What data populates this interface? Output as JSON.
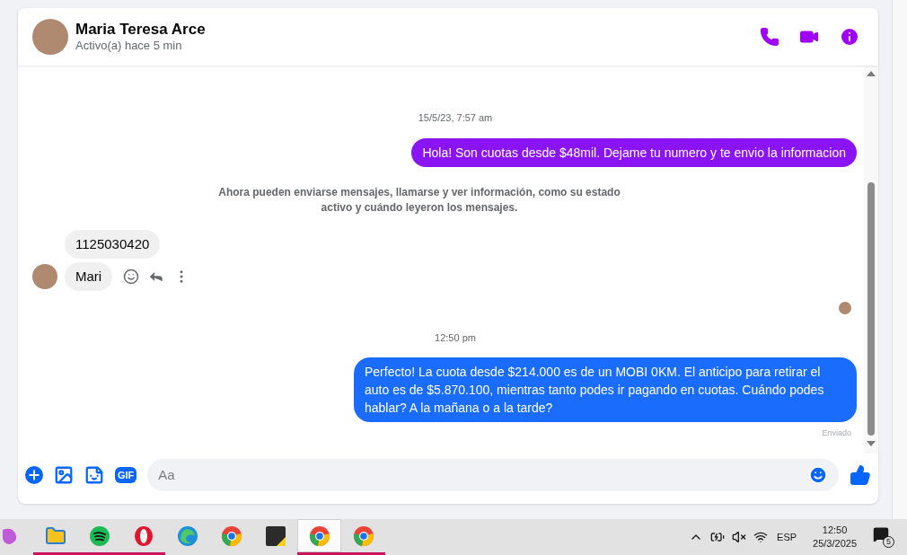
{
  "header": {
    "name": "Maria Teresa Arce",
    "status": "Activo(a) hace 5 min"
  },
  "messages": [
    {
      "kind": "timestamp",
      "text": "15/5/23, 7:57 am"
    },
    {
      "kind": "outgoing",
      "color": "#8b14f5",
      "text": "Hola! Son cuotas desde $48mil. Dejame tu numero  y te envio la informacion"
    },
    {
      "kind": "notice",
      "text": "Ahora pueden enviarse mensajes, llamarse y ver información, como su estado activo y cuándo leyeron los mensajes."
    },
    {
      "kind": "incoming",
      "texts": [
        "1125030420",
        "Mari"
      ]
    },
    {
      "kind": "seen"
    },
    {
      "kind": "timestamp",
      "text": "12:50 pm"
    },
    {
      "kind": "outgoing",
      "color": "#1a6dfc",
      "text": "Perfecto! La cuota desde $214.000 es de un MOBI 0KM. El anticipo para retirar el auto es de $5.870.100, mientras tanto podes ir pagando en cuotas. Cuándo podes hablar? A la mañana o a la tarde?"
    },
    {
      "kind": "delivery",
      "text": "Enviado"
    }
  ],
  "composer": {
    "gif_label": "GIF",
    "placeholder": "Aa"
  },
  "taskbar": {
    "apps": [
      {
        "kind": "copilot",
        "running": false,
        "selected": false
      },
      {
        "kind": "files",
        "running": true,
        "selected": false
      },
      {
        "kind": "spotify",
        "running": true,
        "selected": false
      },
      {
        "kind": "opera",
        "running": true,
        "selected": false
      },
      {
        "kind": "edge",
        "running": false,
        "selected": false
      },
      {
        "kind": "chrome",
        "running": false,
        "selected": false
      },
      {
        "kind": "notes",
        "running": false,
        "selected": false
      },
      {
        "kind": "chrome",
        "running": true,
        "selected": true
      },
      {
        "kind": "chrome",
        "running": true,
        "selected": false
      }
    ],
    "language": "ESP",
    "time": "12:50",
    "date": "25/3/2025",
    "notifications": "5"
  }
}
